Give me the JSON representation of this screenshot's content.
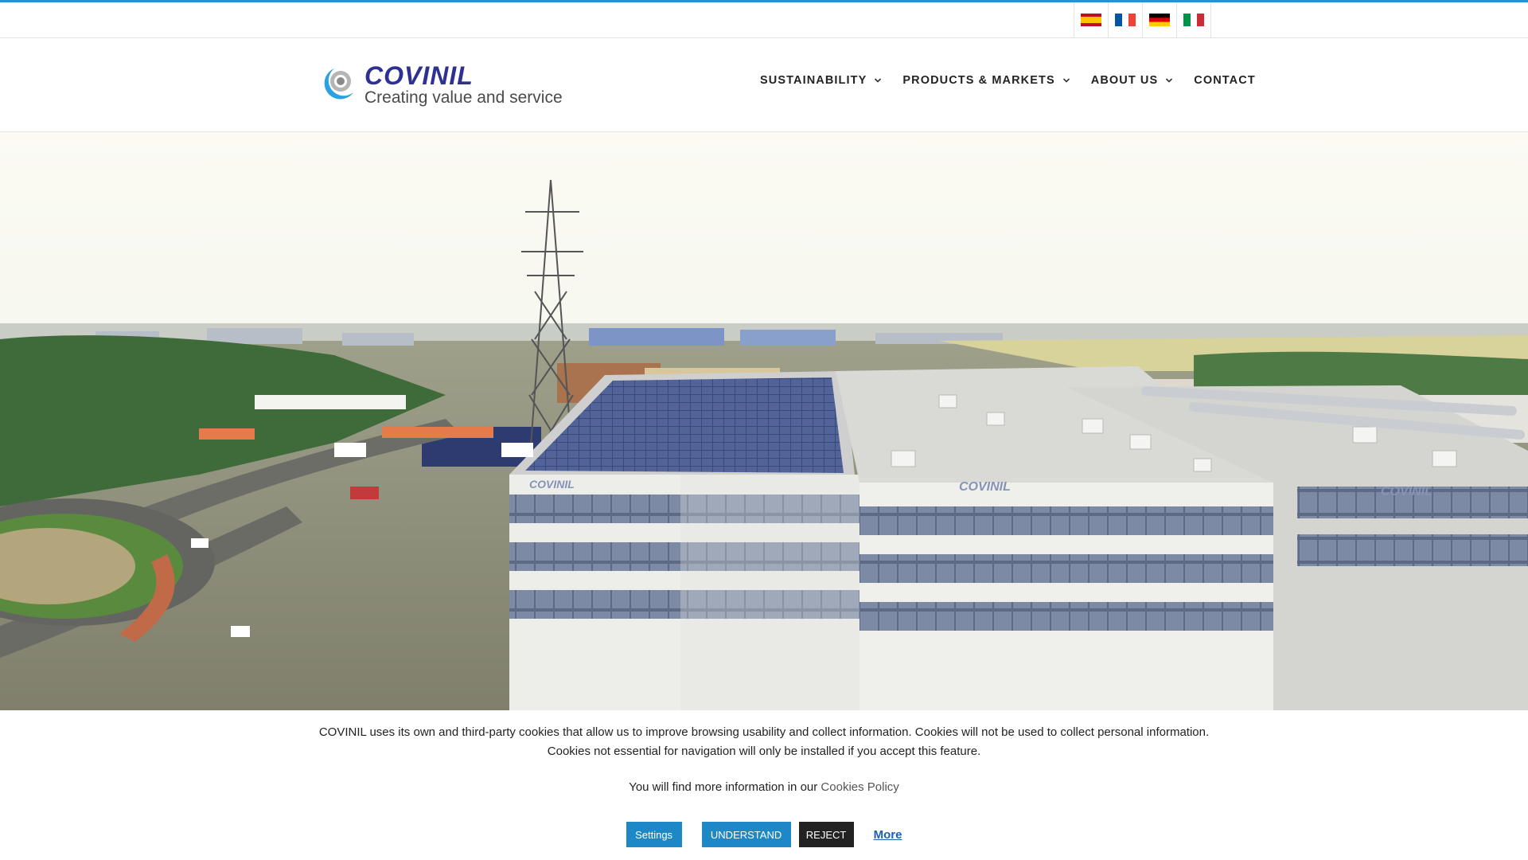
{
  "topbar": {
    "languages": [
      {
        "code": "es",
        "icon": "spain-flag-icon"
      },
      {
        "code": "fr",
        "icon": "france-flag-icon"
      },
      {
        "code": "de",
        "icon": "germany-flag-icon"
      },
      {
        "code": "it",
        "icon": "italy-flag-icon"
      }
    ]
  },
  "logo": {
    "wordmark": "COVINIL",
    "tagline": "Creating value and service"
  },
  "nav": {
    "items": [
      {
        "label": "SUSTAINABILITY",
        "has_dropdown": true
      },
      {
        "label": "PRODUCTS & MARKETS",
        "has_dropdown": true
      },
      {
        "label": "ABOUT US",
        "has_dropdown": true
      },
      {
        "label": "CONTACT",
        "has_dropdown": false
      }
    ]
  },
  "hero": {
    "building_sign": "COVINIL"
  },
  "cookie": {
    "line1": "COVINIL uses its own and third-party cookies that allow us to improve browsing usability and collect information. Cookies will not be used to collect personal information.",
    "line2": "Cookies not essential for navigation will only be installed if you accept this feature.",
    "info_prefix": "You will find more information in our ",
    "policy_link": "Cookies Policy",
    "settings_label": "Settings",
    "understand_label": "UNDERSTAND",
    "reject_label": "REJECT",
    "more_label": "More"
  },
  "colors": {
    "accent": "#1e88c7",
    "brand": "#2e3192",
    "reject": "#222222"
  }
}
